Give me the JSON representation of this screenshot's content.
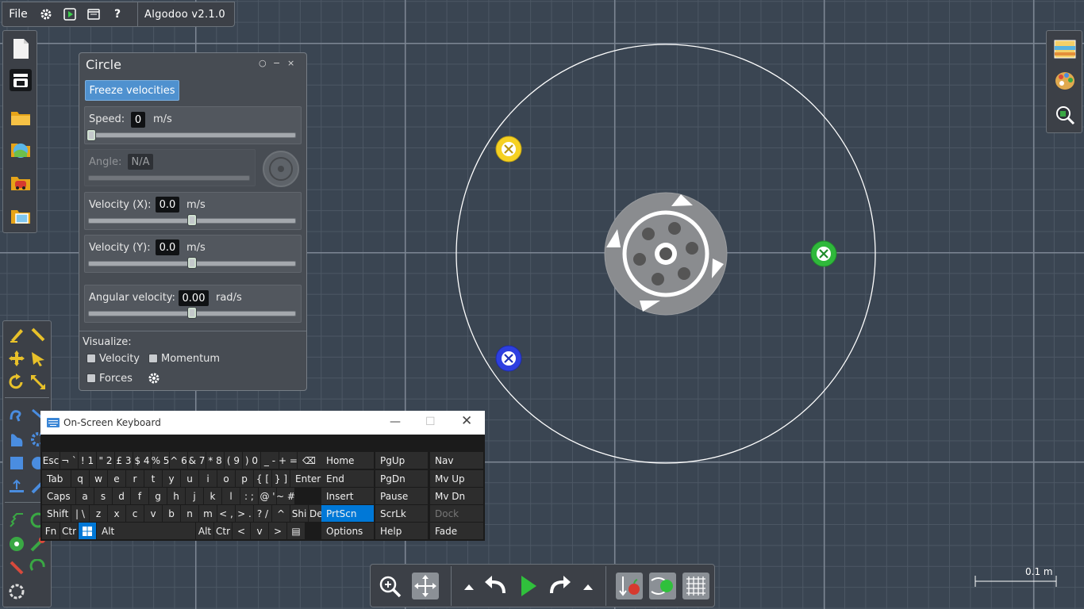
{
  "app": {
    "title": "Algodoo v2.1.0",
    "file_menu": "File"
  },
  "circle_dialog": {
    "title": "Circle",
    "freeze_button": "Freeze velocities",
    "speed": {
      "label": "Speed:",
      "value": "0",
      "unit": "m/s",
      "level": 0.0
    },
    "angle": {
      "label": "Angle:",
      "value": "N/A"
    },
    "velocity_x": {
      "label": "Velocity (X):",
      "value": "0.0",
      "unit": "m/s",
      "level": 0.5
    },
    "velocity_y": {
      "label": "Velocity (Y):",
      "value": "0.0",
      "unit": "m/s",
      "level": 0.5
    },
    "angular_velocity": {
      "label": "Angular velocity:",
      "value": "0.00",
      "unit": "rad/s",
      "level": 0.5
    },
    "visualize": {
      "label": "Visualize:",
      "velocity": "Velocity",
      "momentum": "Momentum",
      "forces": "Forces"
    }
  },
  "osk": {
    "title": "On-Screen Keyboard",
    "rows": [
      [
        "Esc",
        "¬ `",
        "! 1",
        "\" 2",
        "£ 3",
        "$ 4",
        "% 5",
        "^ 6",
        "& 7",
        "* 8",
        "( 9",
        ") 0",
        "_ -",
        "+ =",
        "⌫"
      ],
      [
        "Tab",
        "q",
        "w",
        "e",
        "r",
        "t",
        "y",
        "u",
        "i",
        "o",
        "p",
        "{ [",
        "} ]",
        "Enter"
      ],
      [
        "Caps",
        "a",
        "s",
        "d",
        "f",
        "g",
        "h",
        "j",
        "k",
        "l",
        ": ;",
        "@ '",
        "~ #"
      ],
      [
        "Shift",
        "| \\",
        "z",
        "x",
        "c",
        "v",
        "b",
        "n",
        "m",
        "< ,",
        "> .",
        "? /",
        "^",
        "Shi",
        "Del"
      ],
      [
        "Fn",
        "Ctr",
        "win",
        "Alt",
        "Alt",
        "Ctr",
        "<",
        "v",
        ">",
        "menu"
      ]
    ],
    "nav_keys": [
      [
        "Home",
        "PgUp",
        "Nav"
      ],
      [
        "End",
        "PgDn",
        "Mv Up"
      ],
      [
        "Insert",
        "Pause",
        "Mv Dn"
      ],
      [
        "PrtScn",
        "ScrLk",
        "Dock"
      ],
      [
        "Options",
        "Help",
        "Fade"
      ]
    ]
  },
  "scale": {
    "label": "0.1 m"
  },
  "colors": {
    "accent": "#4f91cf",
    "grid_major": "#7d8794",
    "grid_minor": "#4c5764",
    "background": "#3a4552",
    "osk_highlight": "#0078d7"
  }
}
